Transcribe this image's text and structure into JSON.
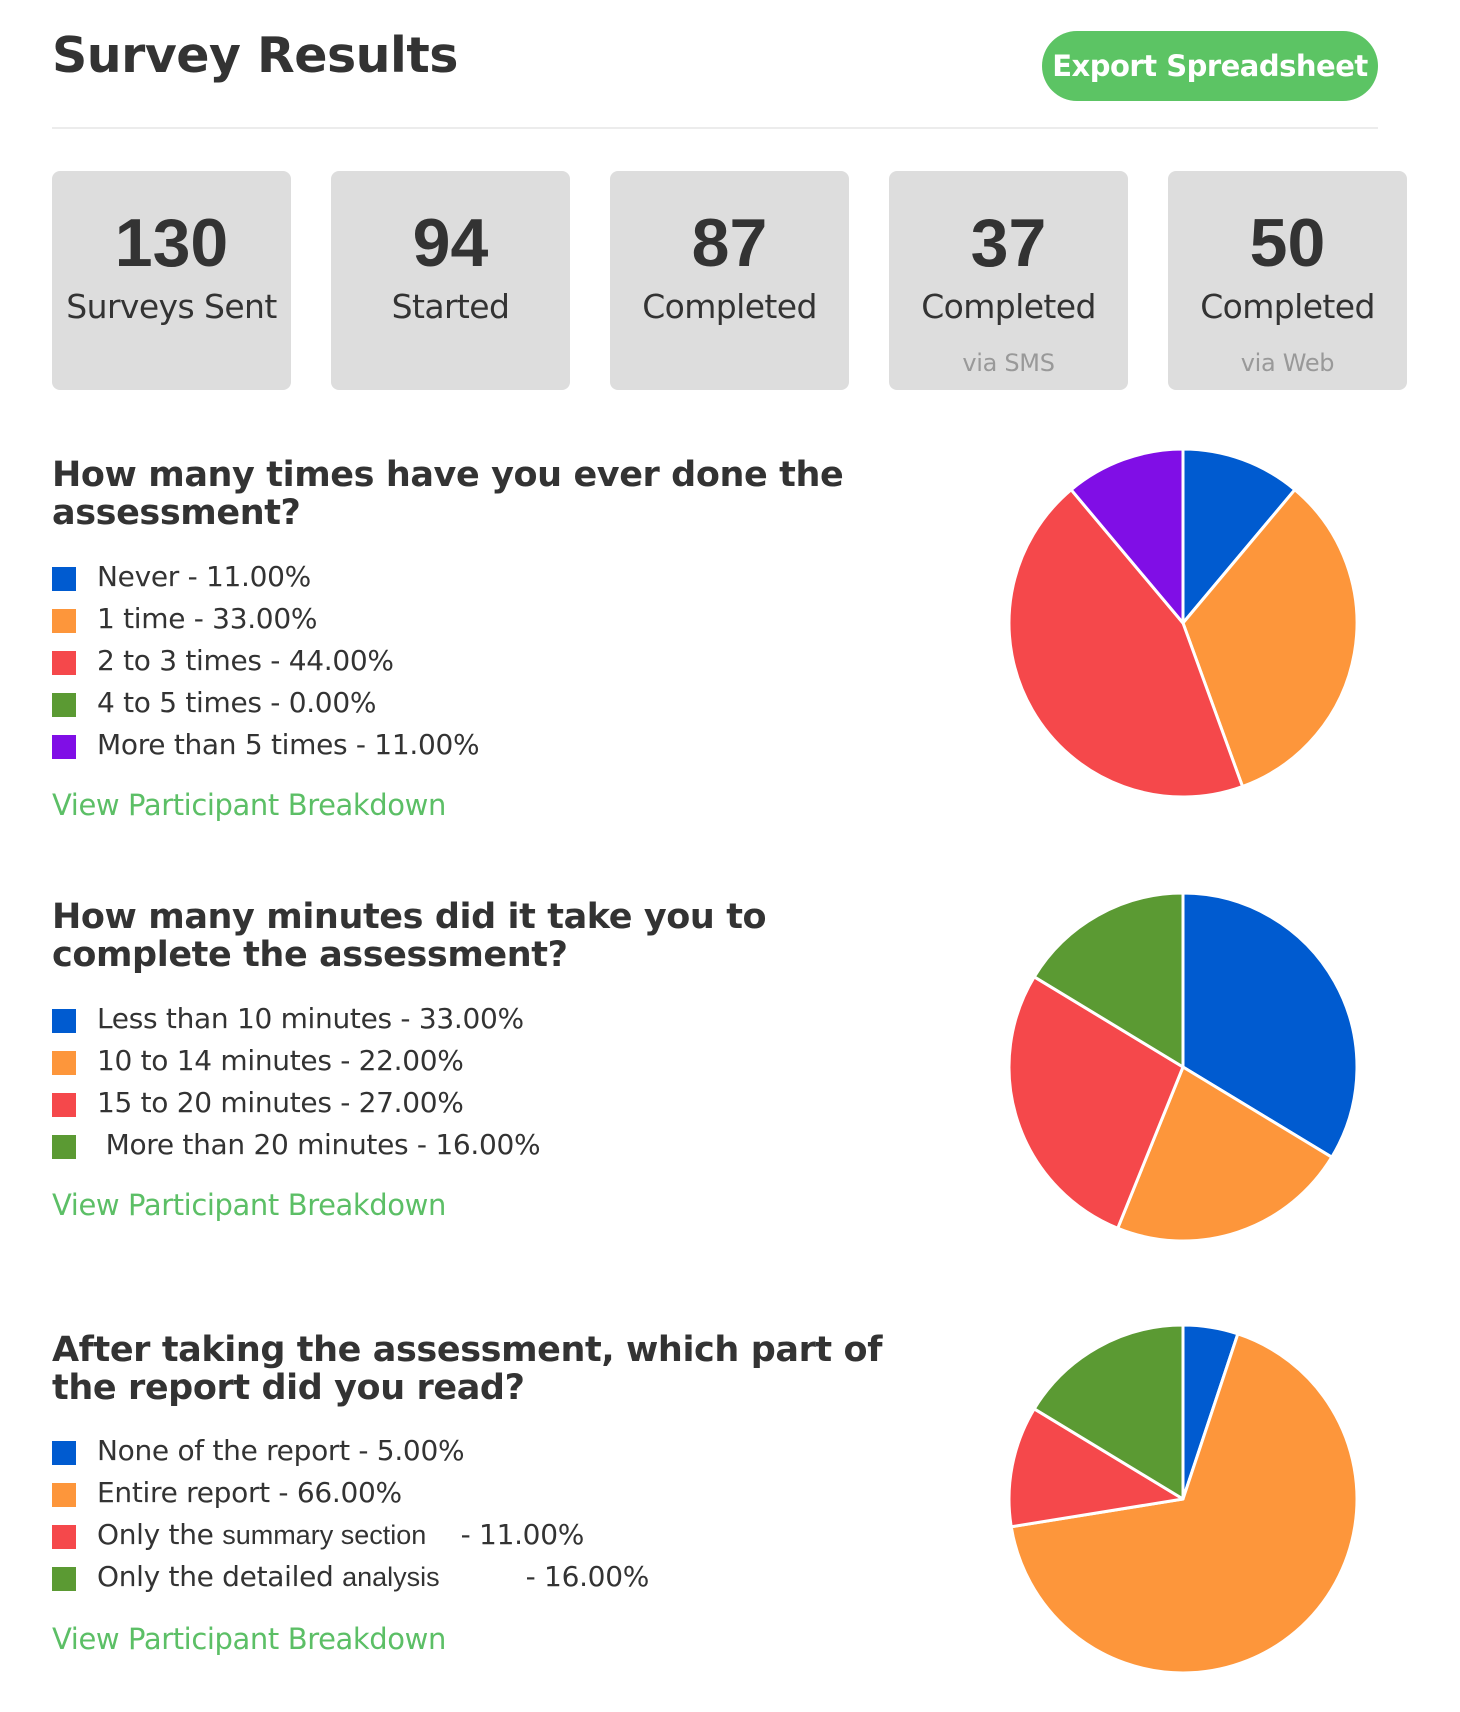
{
  "header": {
    "title": "Survey Results",
    "export_label": "Export Spreadsheet"
  },
  "colors": {
    "accent_green": "#5cc464",
    "link_green": "#5cbf66",
    "blue": "#005bd0",
    "orange": "#fd963b",
    "red": "#f5484b",
    "green": "#5b9a33",
    "purple": "#800ee6"
  },
  "stats": [
    {
      "value": "130",
      "label": "Surveys Sent",
      "sub": ""
    },
    {
      "value": "94",
      "label": "Started",
      "sub": ""
    },
    {
      "value": "87",
      "label": "Completed",
      "sub": ""
    },
    {
      "value": "37",
      "label": "Completed",
      "sub": "via SMS"
    },
    {
      "value": "50",
      "label": "Completed",
      "sub": "via Web"
    }
  ],
  "questions": [
    {
      "title_line1": "How many times have you ever done the",
      "title_line2": "assessment?",
      "link": "View Participant Breakdown",
      "legend": [
        {
          "text": "Never - 11.00%"
        },
        {
          "text": "1 time - 33.00%"
        },
        {
          "text": "2 to 3 times - 44.00%"
        },
        {
          "text": "4 to 5 times - 0.00%"
        },
        {
          "text": "More than 5 times - 11.00%"
        }
      ]
    },
    {
      "title_line1": "How many minutes did it take you to",
      "title_line2": "complete the assessment?",
      "link": "View Participant Breakdown",
      "legend": [
        {
          "text": "Less than 10 minutes - 33.00%"
        },
        {
          "text": "10 to 14 minutes - 22.00%"
        },
        {
          "text": "15 to 20 minutes - 27.00%"
        },
        {
          "text": " More than 20 minutes - 16.00%"
        }
      ]
    },
    {
      "title_line1": "After taking the assessment, which part of",
      "title_line2": "the report did you read?",
      "link": "View Participant Breakdown",
      "legend": [
        {
          "text": "None of the report - 5.00%"
        },
        {
          "text": "Entire report - 66.00%"
        },
        {
          "text_a": "Only the ",
          "text_b": "summary section",
          "text_c": "    - 11.00%"
        },
        {
          "text_a": "Only the detailed ",
          "text_b": "analysis",
          "text_c": "          - 16.00%"
        }
      ]
    }
  ],
  "chart_data": [
    {
      "type": "pie",
      "title": "How many times have you ever done the assessment?",
      "categories": [
        "Never",
        "1 time",
        "2 to 3 times",
        "4 to 5 times",
        "More than 5 times"
      ],
      "values": [
        11,
        33,
        44,
        0,
        11
      ],
      "colors": [
        "#005bd0",
        "#fd963b",
        "#f5484b",
        "#5b9a33",
        "#800ee6"
      ],
      "unit": "%",
      "start": "top, clockwise",
      "legend": "left"
    },
    {
      "type": "pie",
      "title": "How many minutes did it take you to complete the assessment?",
      "categories": [
        "Less than 10 minutes",
        "10 to 14 minutes",
        "15 to 20 minutes",
        "More than 20 minutes"
      ],
      "values": [
        33,
        22,
        27,
        16
      ],
      "colors": [
        "#005bd0",
        "#fd963b",
        "#f5484b",
        "#5b9a33"
      ],
      "unit": "%",
      "start": "top, clockwise",
      "legend": "left"
    },
    {
      "type": "pie",
      "title": "After taking the assessment, which part of the report did you read?",
      "categories": [
        "None of the report",
        "Entire report",
        "Only the summary section",
        "Only the detailed analysis"
      ],
      "values": [
        5,
        66,
        11,
        16
      ],
      "colors": [
        "#005bd0",
        "#fd963b",
        "#f5484b",
        "#5b9a33"
      ],
      "unit": "%",
      "start": "top, clockwise",
      "legend": "left"
    }
  ]
}
